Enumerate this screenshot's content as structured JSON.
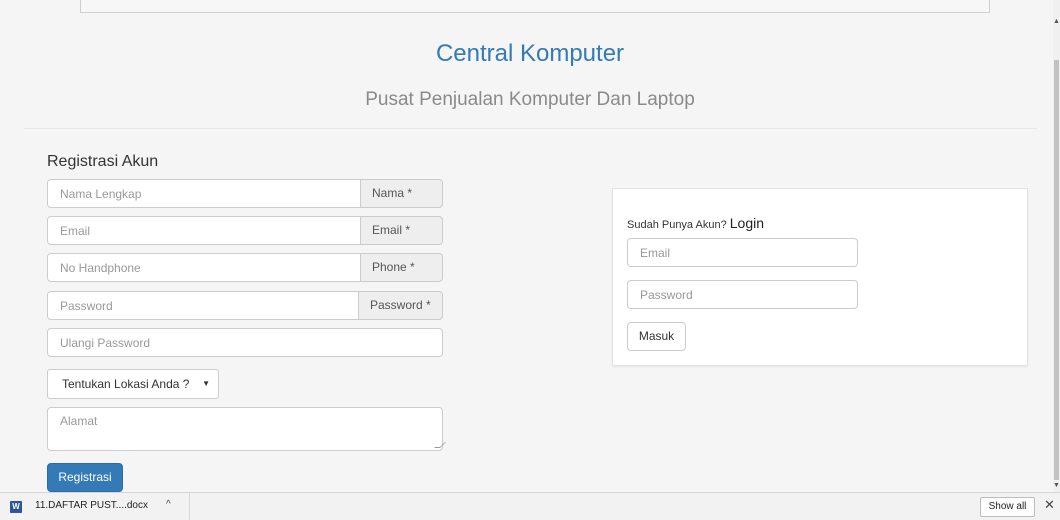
{
  "site": {
    "title": "Central Komputer",
    "subtitle": "Pusat Penjualan Komputer Dan Laptop",
    "brand_color": "#337ab7"
  },
  "register": {
    "heading": "Registrasi Akun",
    "fields": [
      {
        "placeholder": "Nama Lengkap",
        "addon": "Nama *"
      },
      {
        "placeholder": "Email",
        "addon": "Email *"
      },
      {
        "placeholder": "No Handphone",
        "addon": "Phone *"
      },
      {
        "placeholder": "Password",
        "addon": "Password *"
      }
    ],
    "repeat_password_placeholder": "Ulangi Password",
    "location_select": "Tentukan Lokasi Anda ?",
    "address_placeholder": "Alamat",
    "submit_label": "Registrasi"
  },
  "login": {
    "prompt": "Sudah Punya Akun?",
    "heading": "Login",
    "email_placeholder": "Email",
    "password_placeholder": "Password",
    "submit_label": "Masuk"
  },
  "downloads": {
    "file_name": "11.DAFTAR PUST....docx",
    "file_icon": "word-doc-icon",
    "show_all_label": "Show all",
    "caret": "^",
    "close": "✕"
  }
}
